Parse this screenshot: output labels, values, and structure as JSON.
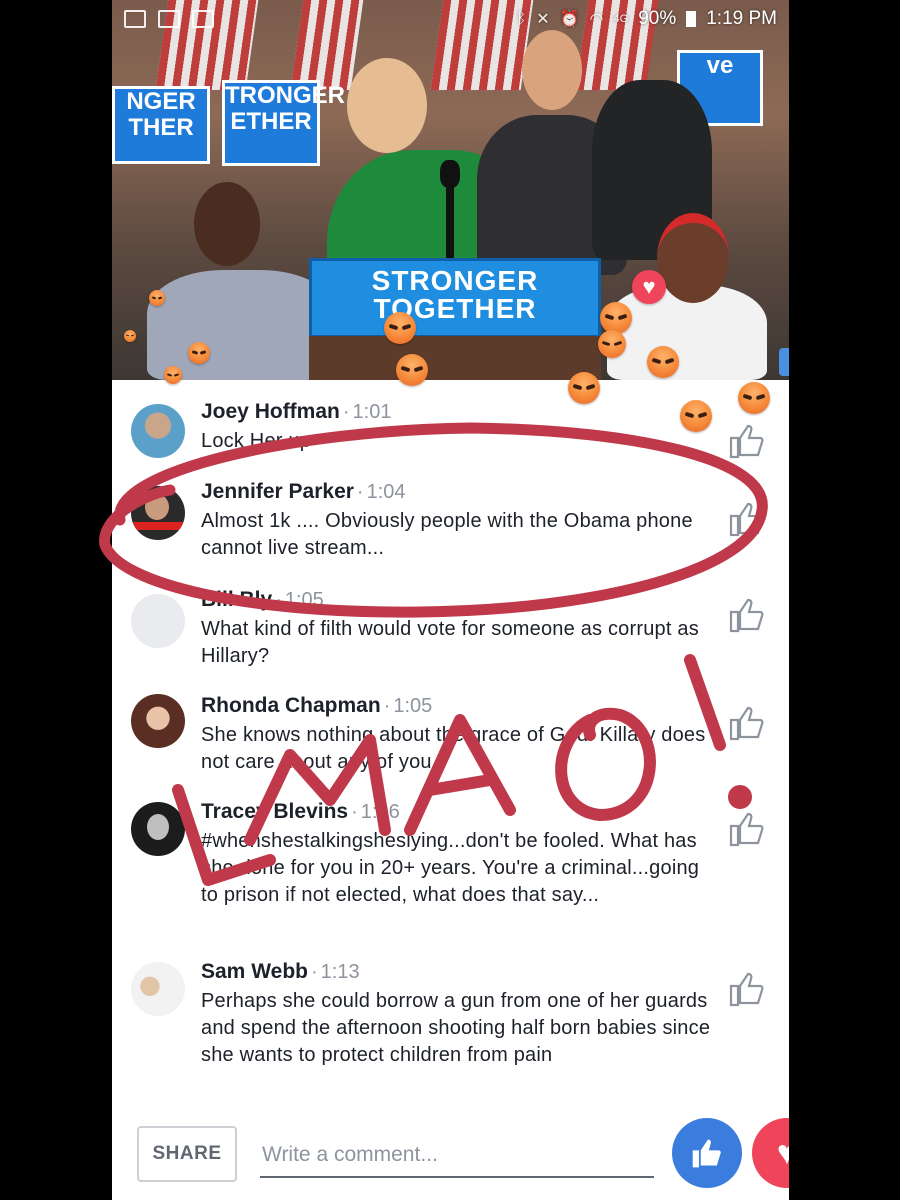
{
  "status_bar": {
    "battery": "90%",
    "time": "1:19 PM",
    "network": "4G"
  },
  "video": {
    "podium_line1": "STRONGER",
    "podium_line2": "TOGETHER",
    "sign_text_1": "NGER\nTHER",
    "sign_text_2": "TRONGER\nETHER",
    "sign_text_3": "ve"
  },
  "comments": [
    {
      "name": "Joey Hoffman",
      "time": "1:01",
      "text": "Lock Her up"
    },
    {
      "name": "Jennifer Parker",
      "time": "1:04",
      "text": "Almost 1k .... Obviously people with the Obama phone cannot live stream..."
    },
    {
      "name": "Bill Bly",
      "time": "1:05",
      "text": "What kind of filth would vote for someone as corrupt as Hillary?"
    },
    {
      "name": "Rhonda Chapman",
      "time": "1:05",
      "text": "She knows nothing about the grace of God. Killary does not care about any of you."
    },
    {
      "name": "Tracey Blevins",
      "time": "1:06",
      "text": "#whenshestalkingsheslying...don't be fooled. What has she done for you in 20+ years. You're a criminal...going to prison if not elected, what does that say..."
    },
    {
      "name": "Sam Webb",
      "time": "1:13",
      "text": "Perhaps she could borrow a gun from one of her guards and spend the afternoon shooting half born babies since she wants to protect children from pain"
    }
  ],
  "bottom_bar": {
    "share_label": "SHARE",
    "comment_placeholder": "Write a comment..."
  },
  "annotation": {
    "handwritten_text": "LMAO!",
    "color": "#c0394a"
  },
  "colors": {
    "like_blue": "#3b7ddd",
    "love_red": "#f0445a",
    "angry_orange": "#f58a3a",
    "name_text": "#1d2129",
    "time_gray": "#8d949e"
  }
}
